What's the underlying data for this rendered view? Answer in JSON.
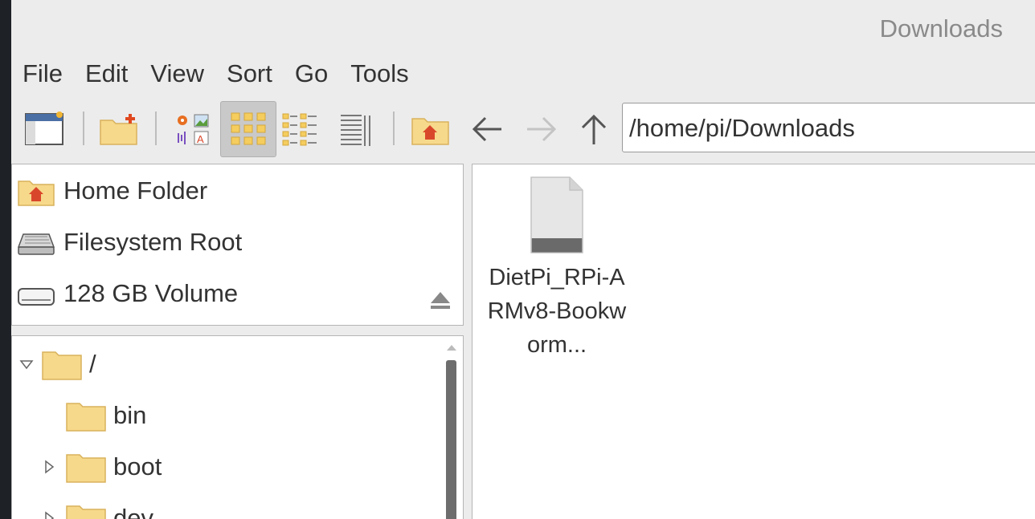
{
  "window": {
    "title": "Downloads"
  },
  "menu": [
    "File",
    "Edit",
    "View",
    "Sort",
    "Go",
    "Tools"
  ],
  "toolbar": {
    "buttons": [
      "sidebar-toggle-icon",
      "new-folder-icon",
      "thumbnail-view-icon",
      "icon-view-icon",
      "compact-view-icon",
      "detailed-list-view-icon",
      "home-icon",
      "back-arrow-icon",
      "forward-arrow-icon",
      "up-arrow-icon"
    ],
    "active_view": "icon-view"
  },
  "address_bar": {
    "value": "/home/pi/Downloads"
  },
  "places": [
    {
      "label": "Home Folder",
      "icon": "home-folder-icon"
    },
    {
      "label": "Filesystem Root",
      "icon": "drive-icon"
    },
    {
      "label": "128 GB Volume",
      "icon": "volume-icon",
      "ejectable": true
    }
  ],
  "tree": [
    {
      "label": "/",
      "expanded": true
    },
    {
      "label": "bin"
    },
    {
      "label": "boot"
    },
    {
      "label": "dev"
    }
  ],
  "files": [
    {
      "name": "DietPi_RPi-ARMv8-Bookworm...",
      "icon": "generic-file-icon"
    }
  ],
  "colors": {
    "folder": "#f7d98b",
    "folder_border": "#d9b25c",
    "home_red": "#d9472b",
    "active_bg": "#c9c9c9"
  }
}
